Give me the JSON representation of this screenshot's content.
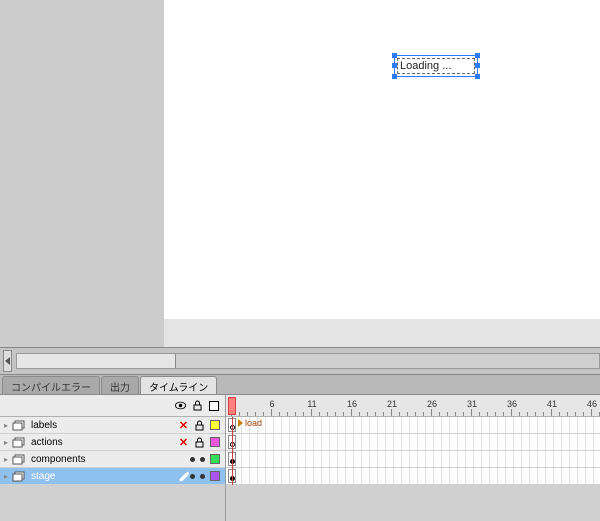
{
  "stage": {
    "selected_text": "Loading ..."
  },
  "tabs": {
    "compiler_errors": "コンパイルエラー",
    "output": "出力",
    "timeline": "タイムライン"
  },
  "timeline": {
    "ruler": {
      "start": 1,
      "step": 5,
      "count": 10
    },
    "layers": [
      {
        "name": "labels",
        "visible_x": true,
        "locked": true,
        "swatch": "#ffff33",
        "frame_label": "load",
        "keyframe": "empty"
      },
      {
        "name": "actions",
        "visible_x": true,
        "locked": true,
        "swatch": "#ee55dd",
        "keyframe": "empty"
      },
      {
        "name": "components",
        "visible_x": false,
        "locked": false,
        "swatch": "#33dd55",
        "keyframe": "filled"
      },
      {
        "name": "stage",
        "visible_x": false,
        "locked": false,
        "swatch": "#aa55ee",
        "keyframe": "filled",
        "active": true
      }
    ]
  }
}
